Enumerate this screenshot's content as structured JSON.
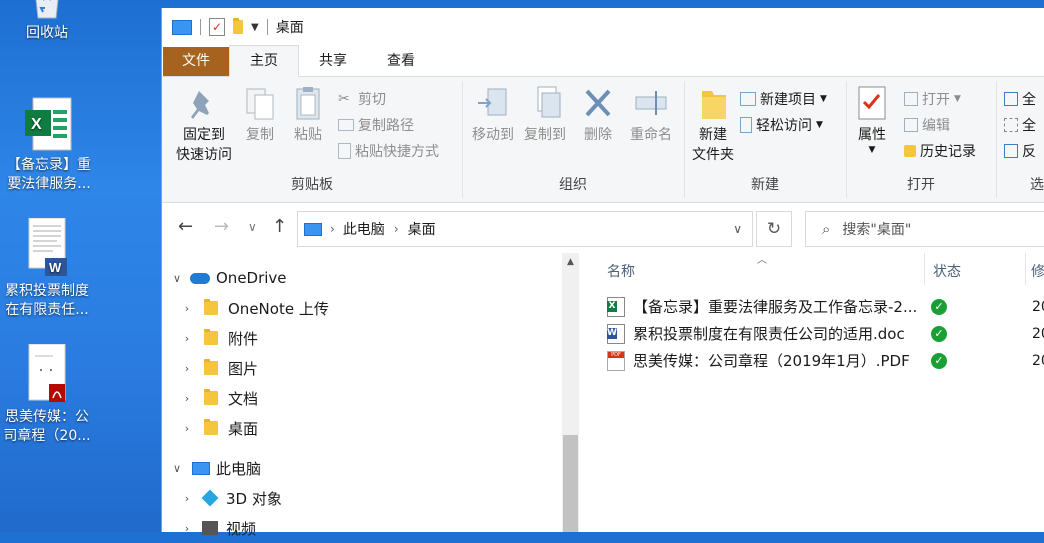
{
  "desktop": {
    "icons": [
      {
        "label": "回收站",
        "icon": "recycle-bin-icon"
      },
      {
        "label": "【备忘录】重要法律服务...",
        "icon": "excel-file-icon"
      },
      {
        "label": "累积投票制度在有限责任...",
        "icon": "word-file-icon"
      },
      {
        "label": "思美传媒：公司章程（20...",
        "icon": "pdf-file-icon"
      }
    ]
  },
  "window": {
    "title": "桌面",
    "tabs": {
      "file": "文件",
      "home": "主页",
      "share": "共享",
      "view": "查看"
    },
    "ribbon": {
      "clipboard": {
        "label": "剪贴板",
        "pin": "固定到\n快速访问",
        "pin1": "固定到",
        "pin2": "快速访问",
        "copy": "复制",
        "paste": "粘贴",
        "cut": "剪切",
        "copy_path": "复制路径",
        "paste_shortcut": "粘贴快捷方式"
      },
      "organize": {
        "label": "组织",
        "move_to": "移动到",
        "copy_to": "复制到",
        "delete": "删除",
        "rename": "重命名"
      },
      "new": {
        "label": "新建",
        "new_folder1": "新建",
        "new_folder2": "文件夹",
        "new_item": "新建项目",
        "easy_access": "轻松访问"
      },
      "open": {
        "label": "打开",
        "properties": "属性",
        "open": "打开",
        "edit": "编辑",
        "history": "历史记录"
      },
      "select": {
        "label": "选",
        "all": "全",
        "none": "全",
        "invert": "反"
      }
    },
    "address": {
      "root": "此电脑",
      "current": "桌面"
    },
    "search": {
      "placeholder": "搜索\"桌面\""
    },
    "navpane": {
      "onedrive": "OneDrive",
      "onedrive_children": [
        "OneNote 上传",
        "附件",
        "图片",
        "文档",
        "桌面"
      ],
      "this_pc": "此电脑",
      "pc_children": [
        "3D 对象",
        "视频"
      ]
    },
    "columns": {
      "name": "名称",
      "status": "状态",
      "date": "修"
    },
    "files": [
      {
        "name": "【备忘录】重要法律服务及工作备忘录-2...",
        "type": "excel",
        "date": "20"
      },
      {
        "name": "累积投票制度在有限责任公司的适用.doc",
        "type": "word",
        "date": "20"
      },
      {
        "name": "思美传媒：公司章程（2019年1月）.PDF",
        "type": "pdf",
        "date": "20"
      }
    ]
  },
  "colors": {
    "file_tab": "#a5631f",
    "status_ok": "#19a034",
    "desktop": "#2a7be0"
  }
}
